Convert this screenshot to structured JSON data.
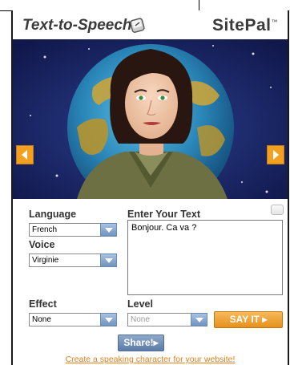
{
  "header": {
    "brand_title": "Text-to-Speech",
    "logo_text": "SitePal",
    "logo_tm": "™"
  },
  "controls": {
    "language": {
      "label": "Language",
      "value": "French"
    },
    "voice": {
      "label": "Voice",
      "value": "Virginie"
    },
    "effect": {
      "label": "Effect",
      "value": "None"
    },
    "level": {
      "label": "Level",
      "value": "None"
    },
    "text_label": "Enter Your Text",
    "text_value": "Bonjour. Ca va ?",
    "say_it": "SAY IT ▸",
    "share": "Share!▸",
    "create_link": "Create a speaking character for your website!"
  },
  "colors": {
    "accent_orange": "#e7901c",
    "accent_blue": "#6f92c0",
    "sky": "#172260"
  },
  "icons": [
    "key-icon",
    "arrow-left-icon",
    "arrow-right-icon",
    "chevron-down-icon"
  ]
}
